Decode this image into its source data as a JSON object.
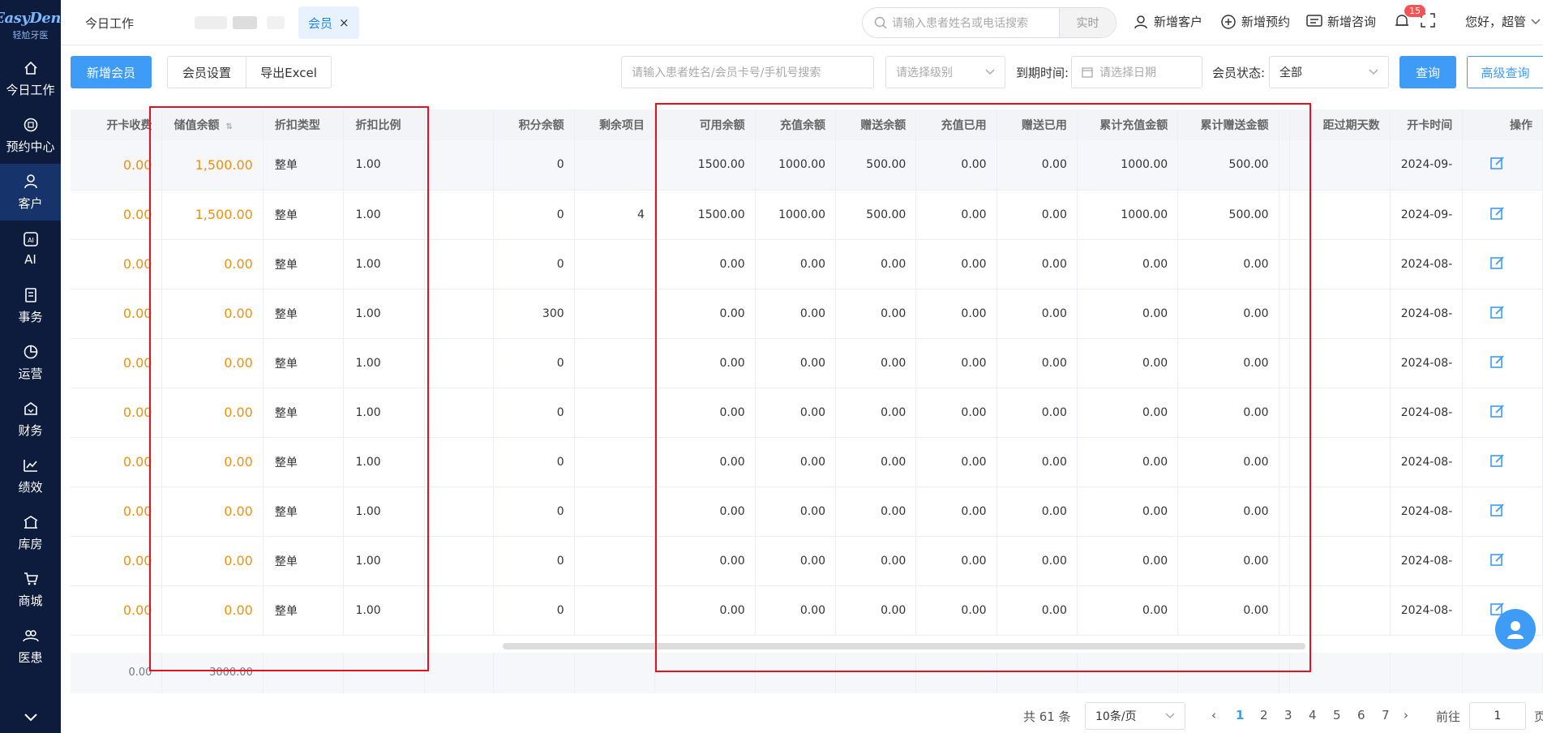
{
  "logo": {
    "brand": "EasyDent",
    "sub": "轻尬牙医"
  },
  "nav": [
    {
      "label": "今日工作",
      "icon": "home-icon"
    },
    {
      "label": "预约中心",
      "icon": "calendar-circle-icon"
    },
    {
      "label": "客户",
      "icon": "user-icon"
    },
    {
      "label": "AI",
      "icon": "ai-icon"
    },
    {
      "label": "事务",
      "icon": "document-icon"
    },
    {
      "label": "运营",
      "icon": "pie-icon"
    },
    {
      "label": "财务",
      "icon": "finance-icon"
    },
    {
      "label": "绩效",
      "icon": "trend-icon"
    },
    {
      "label": "库房",
      "icon": "warehouse-icon"
    },
    {
      "label": "商城",
      "icon": "cart-icon"
    },
    {
      "label": "医患",
      "icon": "people-icon"
    }
  ],
  "topbar": {
    "tab_home": "今日工作",
    "tab_active": "会员",
    "tab_close": "×",
    "search_placeholder": "请输入患者姓名或电话搜索",
    "search_mode": "实时",
    "actions": {
      "new_customer": "新增客户",
      "new_appointment": "新增预约",
      "new_consult": "新增咨询"
    },
    "notif_count": "15",
    "greeting": "您好，超管"
  },
  "toolbar": {
    "add_member": "新增会员",
    "member_settings": "会员设置",
    "export": "导出Excel",
    "search_placeholder": "请输入患者姓名/会员卡号/手机号搜索",
    "level_placeholder": "请选择级别",
    "expiry_label": "到期时间:",
    "date_placeholder": "请选择日期",
    "status_label": "会员状态:",
    "status_value": "全部",
    "query": "查询",
    "advanced": "高级查询"
  },
  "table": {
    "headers": [
      "开卡收费",
      "储值余额",
      "折扣类型",
      "折扣比例",
      "",
      "积分余额",
      "剩余项目",
      "可用余额",
      "充值余额",
      "赠送余额",
      "充值已用",
      "赠送已用",
      "累计充值金额",
      "累计赠送金额",
      "",
      "距过期天数",
      "开卡时间",
      "操作"
    ],
    "rows": [
      [
        "0.00",
        "1,500.00",
        "整单",
        "1.00",
        "",
        "0",
        "",
        "1500.00",
        "1000.00",
        "500.00",
        "0.00",
        "0.00",
        "1000.00",
        "500.00",
        "",
        "",
        "2024-09-"
      ],
      [
        "0.00",
        "1,500.00",
        "整单",
        "1.00",
        "",
        "0",
        "4",
        "1500.00",
        "1000.00",
        "500.00",
        "0.00",
        "0.00",
        "1000.00",
        "500.00",
        "",
        "",
        "2024-09-"
      ],
      [
        "0.00",
        "0.00",
        "整单",
        "1.00",
        "",
        "0",
        "",
        "0.00",
        "0.00",
        "0.00",
        "0.00",
        "0.00",
        "0.00",
        "0.00",
        "",
        "",
        "2024-08-"
      ],
      [
        "0.00",
        "0.00",
        "整单",
        "1.00",
        "",
        "300",
        "",
        "0.00",
        "0.00",
        "0.00",
        "0.00",
        "0.00",
        "0.00",
        "0.00",
        "",
        "",
        "2024-08-"
      ],
      [
        "0.00",
        "0.00",
        "整单",
        "1.00",
        "",
        "0",
        "",
        "0.00",
        "0.00",
        "0.00",
        "0.00",
        "0.00",
        "0.00",
        "0.00",
        "",
        "",
        "2024-08-"
      ],
      [
        "0.00",
        "0.00",
        "整单",
        "1.00",
        "",
        "0",
        "",
        "0.00",
        "0.00",
        "0.00",
        "0.00",
        "0.00",
        "0.00",
        "0.00",
        "",
        "",
        "2024-08-"
      ],
      [
        "0.00",
        "0.00",
        "整单",
        "1.00",
        "",
        "0",
        "",
        "0.00",
        "0.00",
        "0.00",
        "0.00",
        "0.00",
        "0.00",
        "0.00",
        "",
        "",
        "2024-08-"
      ],
      [
        "0.00",
        "0.00",
        "整单",
        "1.00",
        "",
        "0",
        "",
        "0.00",
        "0.00",
        "0.00",
        "0.00",
        "0.00",
        "0.00",
        "0.00",
        "",
        "",
        "2024-08-"
      ],
      [
        "0.00",
        "0.00",
        "整单",
        "1.00",
        "",
        "0",
        "",
        "0.00",
        "0.00",
        "0.00",
        "0.00",
        "0.00",
        "0.00",
        "0.00",
        "",
        "",
        "2024-08-"
      ],
      [
        "0.00",
        "0.00",
        "整单",
        "1.00",
        "",
        "0",
        "",
        "0.00",
        "0.00",
        "0.00",
        "0.00",
        "0.00",
        "0.00",
        "0.00",
        "",
        "",
        "2024-08-"
      ]
    ],
    "summary": [
      "0.00",
      "3000.00"
    ]
  },
  "pagination": {
    "total": "共 61 条",
    "page_size": "10条/页",
    "pages": [
      "1",
      "2",
      "3",
      "4",
      "5",
      "6",
      "7"
    ],
    "current": "1",
    "goto_label": "前往",
    "goto_value": "1",
    "goto_suffix": "页"
  },
  "colors": {
    "sidebar": "#0d1b3d",
    "accent": "#3e9bf6",
    "orange": "#f0900a",
    "highlight": "#e6101e"
  }
}
